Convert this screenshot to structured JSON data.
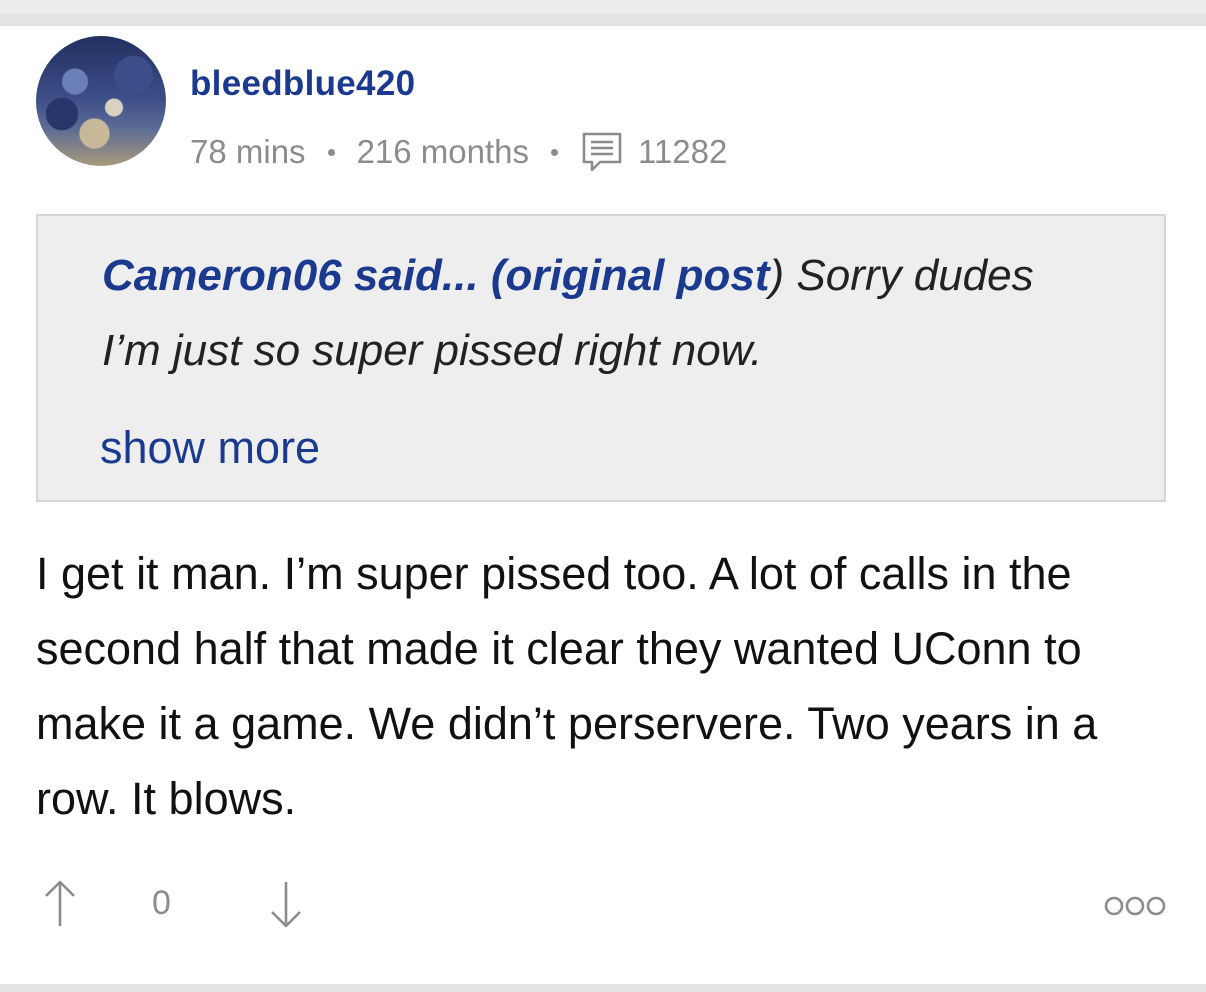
{
  "post": {
    "username": "bleedblue420",
    "time_ago": "78 mins",
    "member_duration": "216 months",
    "post_count": "11282"
  },
  "quote": {
    "author_said": "Cameron06 said...",
    "paren_open": " (",
    "original_post_label": "original post",
    "paren_close": ")",
    "text": " Sorry dudes I’m just so super pissed right now.",
    "show_more_label": "show more"
  },
  "body": {
    "text": "I get it man. I’m super pissed too. A lot of calls in the second half that made it clear they wanted UConn to make it a game. We didn’t perservere. Two years in a row. It blows."
  },
  "actions": {
    "score": "0",
    "upvote_icon": "arrow-up-icon",
    "downvote_icon": "arrow-down-icon",
    "more_icon": "more-options-icon"
  },
  "colors": {
    "accent": "#1b3a8f",
    "meta": "#8c8c8c",
    "quote_bg": "#eeeeee"
  }
}
